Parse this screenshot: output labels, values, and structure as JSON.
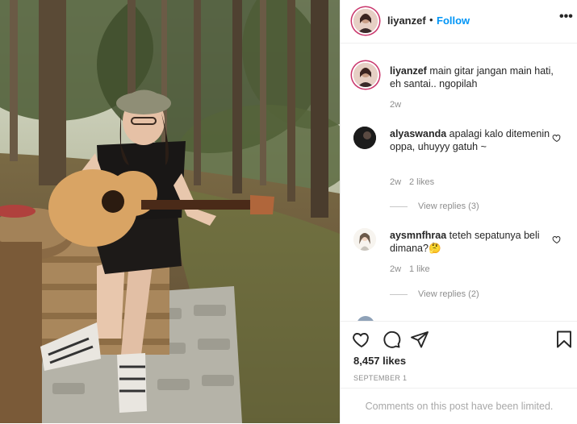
{
  "post": {
    "username": "liyanzef",
    "separator": "•",
    "follow_label": "Follow",
    "more_icon_glyph": "•••",
    "caption": "main gitar jangan main hati, eh santai.. ngopilah",
    "caption_time": "2w"
  },
  "comments": [
    {
      "username": "alyaswanda",
      "text": "apalagi kalo ditemenin oppa, uhuyyy gatuh ~",
      "time": "2w",
      "likes": "2 likes",
      "replies": "View replies (3)",
      "avatar_icon": "dark-avatar"
    },
    {
      "username": "aysmnfhraa",
      "text": "teteh sepatunya beli dimana?🤔",
      "time": "2w",
      "likes": "1 like",
      "replies": "View replies (2)",
      "avatar_icon": "illustrated-girl-avatar"
    }
  ],
  "actions": {
    "icons": [
      "heart-icon",
      "comment-icon",
      "share-icon",
      "bookmark-icon"
    ]
  },
  "stats": {
    "likes": "8,457 likes",
    "date": "SEPTEMBER 1"
  },
  "notice": "Comments on this post have been limited.",
  "colors": {
    "link_blue": "#0095f6",
    "text_dark": "#262626",
    "text_muted": "#8e8e8e",
    "story_ring": "#c9356b"
  }
}
